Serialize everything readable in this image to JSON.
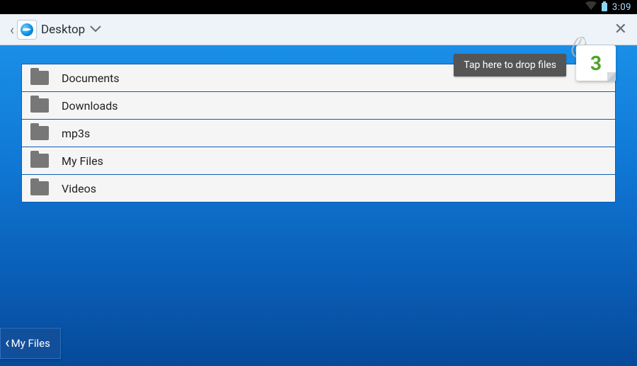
{
  "status": {
    "time": "3:09"
  },
  "appbar": {
    "title": "Desktop"
  },
  "drop_tooltip": "Tap here to drop files",
  "drop_count": "3",
  "folders": [
    {
      "name": "Documents"
    },
    {
      "name": "Downloads"
    },
    {
      "name": "mp3s"
    },
    {
      "name": "My Files"
    },
    {
      "name": "Videos"
    }
  ],
  "bottom_chip": {
    "label": "My Files"
  }
}
